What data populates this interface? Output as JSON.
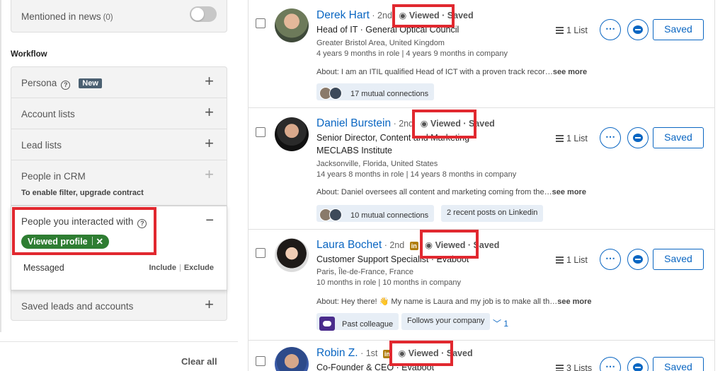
{
  "filters": {
    "mentioned_label": "Mentioned in news",
    "mentioned_count": "(0)",
    "workflow_title": "Workflow",
    "persona_label": "Persona",
    "help_glyph": "?",
    "new_badge": "New",
    "account_lists": "Account lists",
    "lead_lists": "Lead lists",
    "people_crm": "People in CRM",
    "crm_note": "To enable filter, upgrade contract",
    "interacted_label": "People you interacted with",
    "viewed_pill": "Viewed profile",
    "pill_remove": "✕",
    "messaged": "Messaged",
    "include": "Include",
    "exclude": "Exclude",
    "saved_leads": "Saved leads and accounts",
    "plus": "+",
    "minus": "−",
    "clear_all": "Clear all"
  },
  "leads": [
    {
      "name": "Derek Hart",
      "degree": "· 2nd",
      "viewed": "Viewed",
      "saved_tag": "· Saved",
      "title": "Head of IT · General Optical Council",
      "title2": "",
      "location": "Greater Bristol Area, United Kingdom",
      "tenure": "4 years 9 months in role | 4 years 9 months in company",
      "about_label": "About:",
      "about": " I am an ITIL qualified Head of ICT with a proven track recor…",
      "see_more": "see more",
      "chip1": "17 mutual connections",
      "lists": "1 List",
      "saved_btn": "Saved"
    },
    {
      "name": "Daniel Burstein",
      "degree": "· 2nd",
      "viewed": "Viewed",
      "saved_tag": "· Saved",
      "title": "Senior Director, Content and Marketing ·",
      "title2": "MECLABS Institute",
      "location": "Jacksonville, Florida, United States",
      "tenure": "14 years 8 months in role | 14 years 8 months in company",
      "about_label": "About:",
      "about": " Daniel oversees all content and marketing coming from the…",
      "see_more": "see more",
      "chip1": "10 mutual connections",
      "chip2": "2 recent posts on Linkedin",
      "lists": "1 List",
      "saved_btn": "Saved"
    },
    {
      "name": "Laura Bochet",
      "degree": "· 2nd",
      "li": "in",
      "viewed": "Viewed",
      "saved_tag": "· Saved",
      "title": "Customer Support Specialist · Evaboot",
      "title2": "",
      "location": "Paris, Île-de-France, France",
      "tenure": "10 months in role | 10 months in company",
      "about_label": "About:",
      "about": " Hey there! 👋 My name is Laura and my job is to make all th…",
      "see_more": "see more",
      "chip1": "Past colleague",
      "chip2": "Follows your company",
      "chev": "﹀ 1",
      "lists": "1 List",
      "saved_btn": "Saved"
    },
    {
      "name": "Robin Z.",
      "degree": "· 1st",
      "li": "in",
      "viewed": "Viewed",
      "saved_tag": "· Saved",
      "title": "Co-Founder & CEO · Evaboot",
      "lists": "3 Lists",
      "saved_btn": "Saved"
    }
  ],
  "icons": {
    "more": "⋯",
    "eye": "◉"
  },
  "colors": {
    "link": "#0a66c2",
    "highlight": "#e1282f",
    "pill": "#2e7d32"
  }
}
